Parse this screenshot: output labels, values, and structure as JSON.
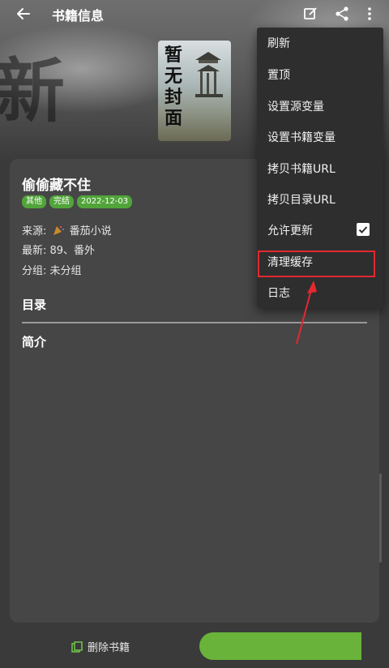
{
  "toolbar": {
    "title": "书籍信息",
    "icons": [
      "back-arrow-icon",
      "edit-icon",
      "share-icon",
      "more-vert-icon"
    ]
  },
  "cover": {
    "text": "暂无封面"
  },
  "hero": {
    "watermark": "新"
  },
  "book": {
    "title": "偷偷藏不住",
    "tags": [
      "其他",
      "完结",
      "2022-12-03"
    ],
    "source_label": "来源:",
    "source_name": "番茄小说",
    "latest": "最新: 89、番外",
    "group": "分组: 未分组"
  },
  "sections": {
    "toc": "目录",
    "intro": "简介"
  },
  "bottom": {
    "delete_label": "删除书籍"
  },
  "menu": {
    "items": [
      "刷新",
      "置顶",
      "设置源变量",
      "设置书籍变量",
      "拷贝书籍URL",
      "拷贝目录URL",
      "允许更新",
      "清理缓存",
      "日志"
    ],
    "allow_update_checked": true,
    "highlighted_item": "清理缓存"
  },
  "colors": {
    "accent_green": "#69b33a",
    "tag_green": "#51a43a",
    "annotation_red": "#e3292f"
  }
}
